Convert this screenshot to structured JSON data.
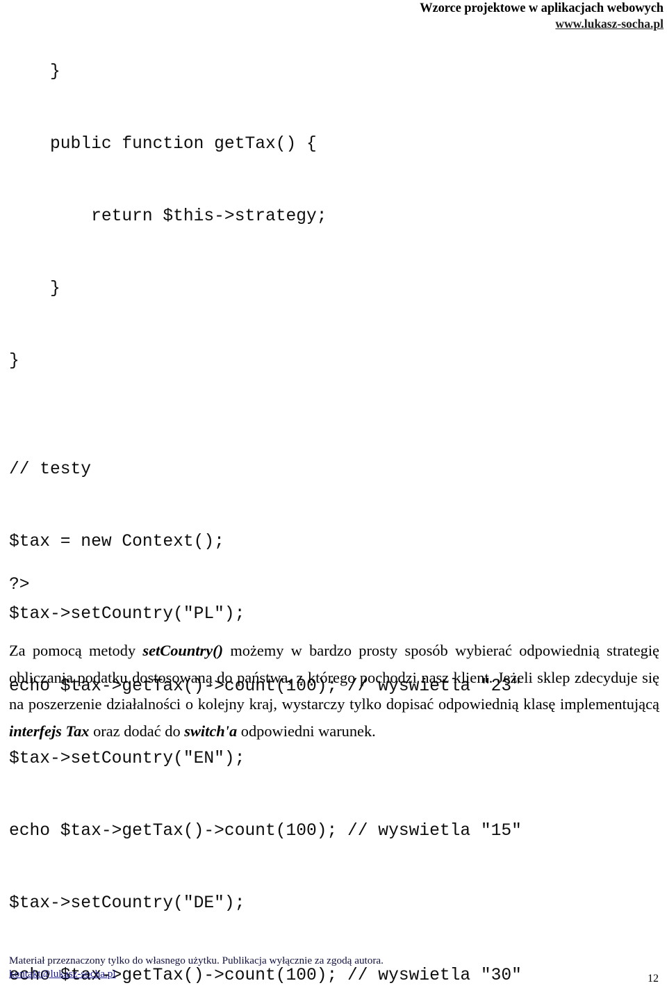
{
  "header": {
    "title": "Wzorce projektowe w aplikacjach webowych",
    "site": "www.lukasz-socha.pl"
  },
  "code": {
    "lines": [
      "    }",
      "",
      "    public function getTax() {",
      "",
      "        return $this->strategy;",
      "",
      "    }",
      "",
      "}",
      "",
      "",
      "// testy",
      "",
      "$tax = new Context();",
      "",
      "$tax->setCountry(\"PL\");",
      "",
      "echo $tax->getTax()->count(100); // wyswietla \"23\"",
      "",
      "$tax->setCountry(\"EN\");",
      "",
      "echo $tax->getTax()->count(100); // wyswietla \"15\"",
      "",
      "$tax->setCountry(\"DE\");",
      "",
      "echo $tax->getTax()->count(100); // wyswietla \"30\""
    ],
    "php_close_tag": "?>"
  },
  "body": {
    "paragraph": {
      "seg1": "Za pomocą metody ",
      "em1": "setCountry()",
      "seg2": " możemy w bardzo prosty sposób wybierać odpowiednią strategię obliczania podatku dostosowaną do państwa, z którego pochodzi nasz klient. Jeżeli sklep zdecyduje się na poszerzenie działalności o kolejny kraj, wystarczy tylko dopisać odpowiednią klasę implementującą ",
      "em2": "interfejs Tax",
      "seg3": " oraz dodać do ",
      "em3": "switch'a",
      "seg4": " odpowiedni warunek."
    }
  },
  "footer": {
    "note": "Materiał przeznaczony tylko do własnego użytku. Publikacja wyłącznie za zgodą autora.",
    "email": "kontakt@lukasz-socha.pl",
    "page_number": "12"
  },
  "colors": {
    "text": "#000000",
    "code": "#0d0d0d",
    "link": "#1b1b8f",
    "footer_note": "#101040",
    "background": "#ffffff"
  }
}
